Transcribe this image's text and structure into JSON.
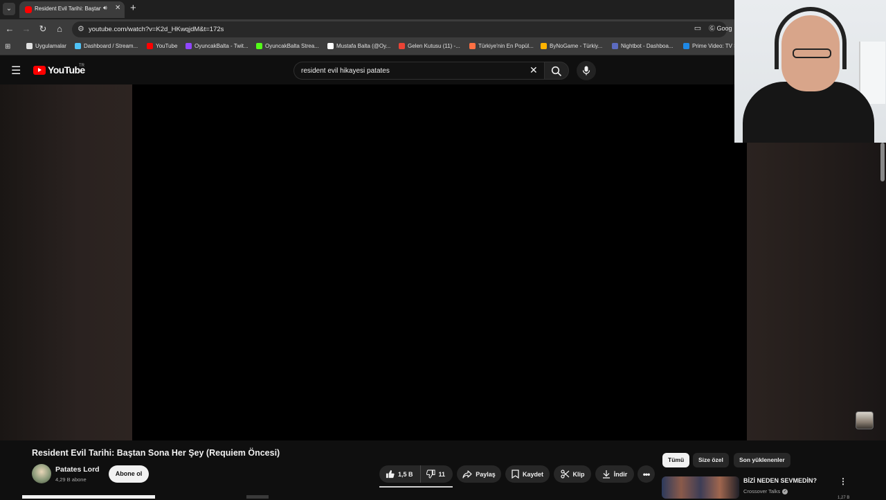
{
  "browser": {
    "tab_title": "Resident Evil Tarihi: Baştan Sona Her Şey (Requiem Öncesi)",
    "new_tab": "+",
    "close": "✕",
    "url": "youtube.com/watch?v=K2d_HKwqjdM&t=172s",
    "profile_label": "Goog"
  },
  "bookmarks": [
    {
      "label": "Uygulamalar",
      "color": "#e0e0e0"
    },
    {
      "label": "Dashboard / Stream...",
      "color": "#4fc3f7"
    },
    {
      "label": "YouTube",
      "color": "#ff0000"
    },
    {
      "label": "OyuncakBalta - Twit...",
      "color": "#9146ff"
    },
    {
      "label": "OyuncakBalta Strea...",
      "color": "#53fc18"
    },
    {
      "label": "Mustafa Balta (@Oy...",
      "color": "#ffffff"
    },
    {
      "label": "Gelen Kutusu (11) -...",
      "color": "#ea4335"
    },
    {
      "label": "Türkiye'nin En Popül...",
      "color": "#ff7043"
    },
    {
      "label": "ByNoGame - Türkiy...",
      "color": "#ffb300"
    },
    {
      "label": "Nightbot - Dashboa...",
      "color": "#5c6bc0"
    },
    {
      "label": "Prime Video: TV S",
      "color": "#1e88e5"
    }
  ],
  "youtube": {
    "logo": "YouTube",
    "country": "TR",
    "search_query": "resident evil hikayesi patates"
  },
  "video": {
    "title": "Resident Evil Tarihi: Baştan Sona Her Şey (Requiem Öncesi)",
    "channel": "Patates Lord",
    "subscribers": "4,29 B abone",
    "subscribe_label": "Abone ol",
    "likes": "1,5 B",
    "dislikes": "11",
    "share_label": "Paylaş",
    "save_label": "Kaydet",
    "clip_label": "Klip",
    "download_label": "İndir"
  },
  "chips": [
    "Tümü",
    "Size özel",
    "Son yüklenenler"
  ],
  "recommendation": {
    "title": "BİZİ NEDEN SEVMEDİN?",
    "channel": "Crossover Talks",
    "views": "1,27 B"
  },
  "colors": {
    "accent": "#ff0000",
    "background": "#0f0f0f",
    "chip": "#272727"
  }
}
